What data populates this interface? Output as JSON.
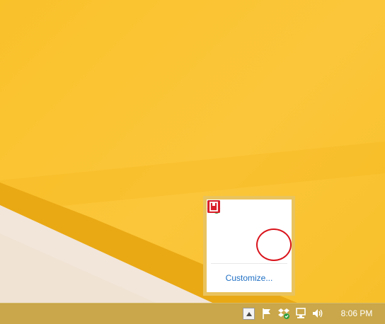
{
  "tray_flyout": {
    "icons": [
      {
        "name": "usb-safely-remove-icon"
      },
      {
        "name": "onedrive-cloud-icon"
      },
      {
        "name": "quicken-q-icon"
      },
      {
        "name": "blue-app-icon"
      },
      {
        "name": "colorful-ball-icon"
      },
      {
        "name": "red-app-icon",
        "highlighted": true
      }
    ],
    "customize_label": "Customize..."
  },
  "taskbar": {
    "clock": "8:06 PM",
    "icons": [
      "show-hidden-icons-button",
      "action-center-flag-icon",
      "dropbox-icon",
      "network-icon",
      "volume-icon"
    ]
  },
  "colors": {
    "desktop": "#f9c22b",
    "taskbar": "#c9a74a",
    "flyout_border": "#e9c35d",
    "link": "#1e6fc4",
    "highlight_circle": "#d9141c"
  }
}
